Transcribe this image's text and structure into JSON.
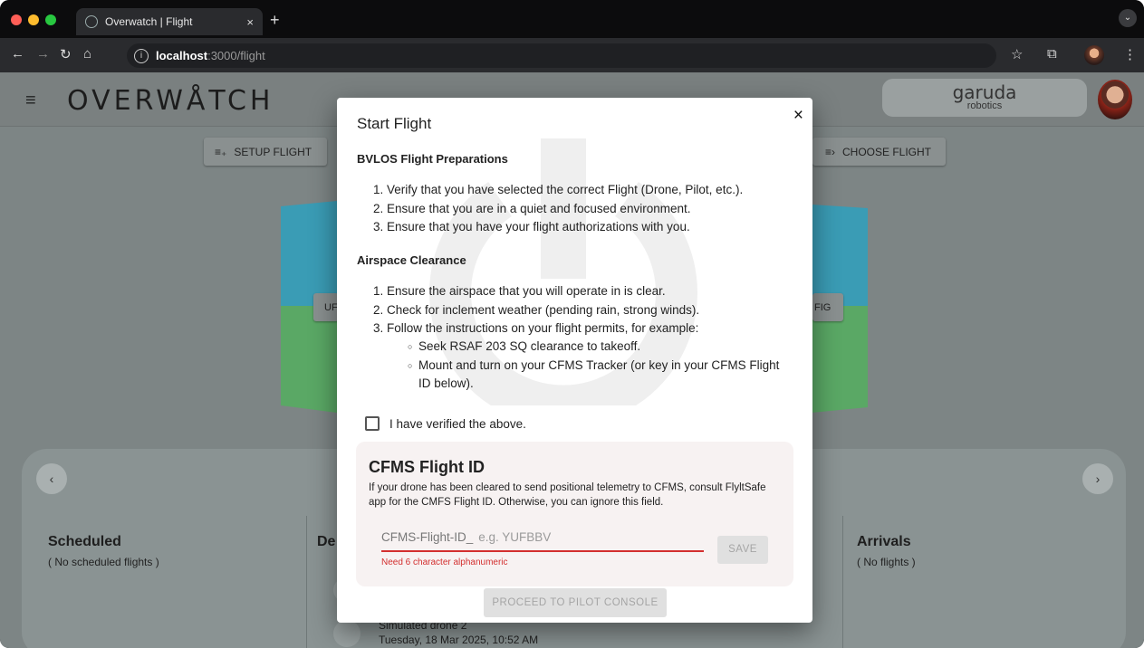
{
  "browser": {
    "tab_title": "Overwatch | Flight",
    "tab_close": "×",
    "new_tab": "+",
    "url_host": "localhost",
    "url_path": ":3000/flight",
    "menu_glyph": "⋮",
    "tab_menu_glyph": "⌄"
  },
  "app": {
    "logo": "OVERWÅTCH",
    "brand_main": "garuda",
    "brand_sub": "robotics",
    "setup_flight": "SETUP FLIGHT",
    "choose_flight": "CHOOSE FLIGHT",
    "left_frag": "UF",
    "right_frag": "FIG",
    "columns": [
      {
        "title": "Scheduled",
        "sub": "( No scheduled flights )"
      },
      {
        "title": "De",
        "sub": ""
      },
      {
        "title": "Arrivals",
        "sub": "( No flights )"
      }
    ],
    "behind_drone": "Simulated drone 2",
    "behind_date": "Tuesday, 18 Mar 2025, 10:52 AM"
  },
  "modal": {
    "title": "Start Flight",
    "close": "×",
    "section1": "BVLOS Flight Preparations",
    "prep_items": [
      "1. Verify that you have selected the correct Flight (Drone, Pilot, etc.).",
      "2. Ensure that you are in a quiet and focused environment.",
      "3. Ensure that you have your flight authorizations with you."
    ],
    "section2": "Airspace Clearance",
    "air_items": [
      "1. Ensure the airspace that you will operate in is clear.",
      "2. Check for inclement weather (pending rain, strong winds).",
      "3. Follow the instructions on your flight permits, for example:"
    ],
    "air_sub": [
      "Seek RSAF 203 SQ clearance to takeoff.",
      "Mount and turn on your CFMS Tracker (or key in your CFMS Flight",
      "ID below)."
    ],
    "checkbox_label": "I have verified the above.",
    "cfms_title": "CFMS Flight ID",
    "cfms_desc": "If your drone has been cleared to send positional telemetry to CFMS, consult FlyltSafe app for the CMFS Flight ID. Otherwise, you can ignore this field.",
    "cfms_label": "CFMS-Flight-ID_",
    "cfms_placeholder": "e.g. YUFBBV",
    "cfms_error": "Need 6 character alphanumeric",
    "save": "SAVE",
    "proceed": "PROCEED TO PILOT CONSOLE"
  }
}
